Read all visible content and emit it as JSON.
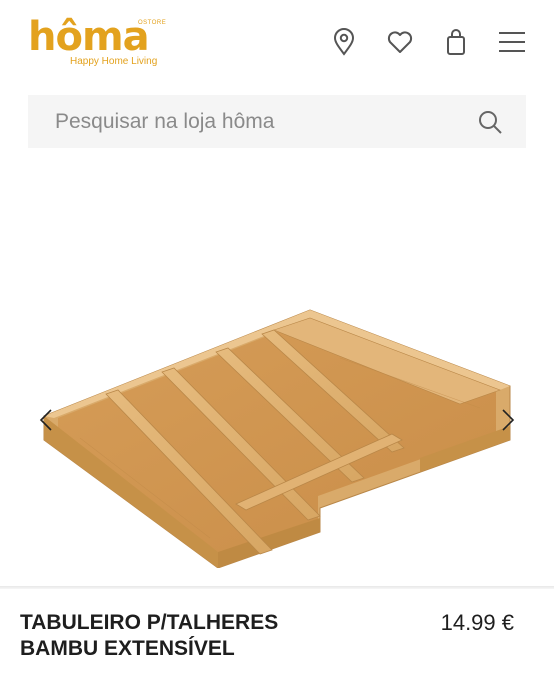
{
  "header": {
    "logo": {
      "word": "hôma",
      "store": "OSTORE",
      "tagline": "Happy Home Living"
    },
    "icons": [
      "location-pin-icon",
      "heart-icon",
      "shopping-bag-icon",
      "hamburger-menu-icon"
    ]
  },
  "search": {
    "placeholder": "Pesquisar na loja hôma",
    "value": ""
  },
  "product": {
    "name": "TABULEIRO P/TALHERES BAMBU EXTENSÍVEL",
    "price": "14.99 €"
  },
  "colors": {
    "brand": "#e3a21e",
    "text": "#1e1e1e",
    "search_bg": "#f5f5f5",
    "bamboo": "#dcae70"
  }
}
